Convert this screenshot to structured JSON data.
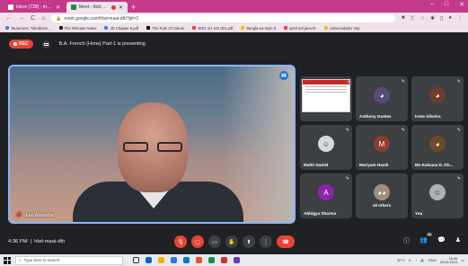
{
  "browser": {
    "tabs": [
      {
        "label": "Inbox (728) - mouyk@suggara",
        "active": false,
        "favicon_color": "#ffffff"
      },
      {
        "label": "Meet - hbd-maai-dth",
        "active": true,
        "recording": true,
        "favicon_color": "#1e8e3e"
      }
    ],
    "new_tab": "+",
    "window_controls": [
      "–",
      "□",
      "✕"
    ],
    "nav": {
      "back": "←",
      "forward": "→",
      "reload": "C",
      "home": "⌂"
    },
    "address": "meet.google.com/hbd-maai-dth?pli=1",
    "bookmarks": [
      {
        "label": "Tautomers, Tokothohe...",
        "color": "#4285f4"
      },
      {
        "label": "The Release Notes",
        "color": "#202124"
      },
      {
        "label": "JD Chapter 6.pdf",
        "color": "#4285f4"
      },
      {
        "label": "The Rule of Culture",
        "color": "#000000"
      },
      {
        "label": "ENG 1H 102 001.pdf",
        "color": "#ea4335"
      },
      {
        "label": "Bangla-ea-style.d",
        "color": "#fbbc04"
      },
      {
        "label": "ops3 sal-janu-th",
        "color": "#ea4335"
      },
      {
        "label": "Universidadcr Imp",
        "color": "#fbbc04"
      }
    ]
  },
  "meet": {
    "rec_label": "REC",
    "presenting_text": "B.A. French (Hons) Part-1 is presenting",
    "main_speaker": {
      "name": "Joel Almeida"
    },
    "participants": [
      {
        "name": "",
        "type": "shared",
        "tag": "2"
      },
      {
        "name": "Anthony Gomes",
        "type": "photo",
        "color": "#5a4a7a"
      },
      {
        "name": "Irene Silveira",
        "type": "photo",
        "color": "#6b3e2e"
      },
      {
        "name": "Maitri Daniel",
        "type": "photo",
        "color": "#d9d9d9"
      },
      {
        "name": "Mariyam Hasib",
        "type": "initial",
        "initial": "M",
        "color": "#8d3d2c"
      },
      {
        "name": "Ms Kalsana D. Dh...",
        "type": "photo",
        "color": "#6b4a2a"
      },
      {
        "name": "Abhigya Sharma",
        "type": "initial",
        "initial": "A",
        "color": "#8e24aa"
      },
      {
        "name": "19 others",
        "type": "group",
        "color": "#9c8f7f"
      },
      {
        "name": "You",
        "type": "photo",
        "color": "#b0b0b0"
      }
    ],
    "meeting_time": "4:36 PM",
    "meeting_code": "hbd-maai-dth",
    "controls": [
      {
        "name": "mic-off",
        "glyph": "🎙"
      },
      {
        "name": "camera-off",
        "glyph": "▢"
      },
      {
        "name": "captions",
        "glyph": "▭"
      },
      {
        "name": "raise-hand",
        "glyph": "✋"
      },
      {
        "name": "present",
        "glyph": "⬆"
      },
      {
        "name": "more",
        "glyph": "⋮"
      },
      {
        "name": "leave-call",
        "glyph": "☎"
      }
    ],
    "right_controls": {
      "info": "ⓘ",
      "people_count": "28",
      "chat": "💬",
      "activities": "♟"
    }
  },
  "taskbar": {
    "search_placeholder": "Type here to search",
    "weather": "32°C",
    "time": "16:36",
    "date": "29-05-2023",
    "lang": "ENG"
  },
  "colors": {
    "accent": "#8ab4f8",
    "danger": "#ea4335",
    "bg": "#202124"
  }
}
